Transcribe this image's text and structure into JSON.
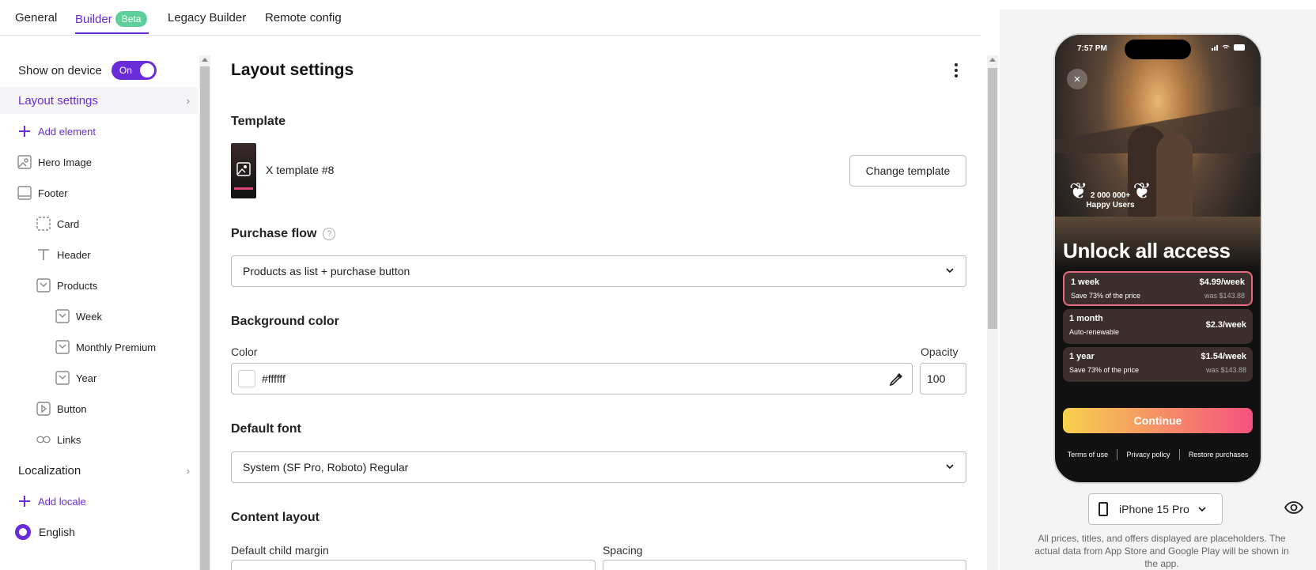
{
  "tabs": {
    "general": "General",
    "builder": "Builder",
    "builder_badge": "Beta",
    "legacy": "Legacy Builder",
    "remote": "Remote config"
  },
  "sidebar": {
    "show_on_device": "Show on device",
    "toggle_label": "On",
    "layout_settings": "Layout settings",
    "add_element": "Add element",
    "items": [
      {
        "label": "Hero Image"
      },
      {
        "label": "Footer"
      },
      {
        "label": "Card"
      },
      {
        "label": "Header"
      },
      {
        "label": "Products"
      },
      {
        "label": "Week"
      },
      {
        "label": "Monthly Premium"
      },
      {
        "label": "Year"
      },
      {
        "label": "Button"
      },
      {
        "label": "Links"
      }
    ],
    "localization": "Localization",
    "add_locale": "Add locale",
    "locale": "English"
  },
  "main": {
    "title": "Layout settings",
    "template_title": "Template",
    "template_name": "X template #8",
    "change_template": "Change template",
    "purchase_flow_title": "Purchase flow",
    "purchase_flow_help": "?",
    "purchase_flow_value": "Products as list + purchase button",
    "background_title": "Background color",
    "color_label": "Color",
    "color_value": "#ffffff",
    "opacity_label": "Opacity",
    "opacity_value": "100",
    "default_font_title": "Default font",
    "default_font_value": "System (SF Pro, Roboto) Regular",
    "content_layout_title": "Content layout",
    "child_margin_label": "Default child margin",
    "spacing_label": "Spacing"
  },
  "preview": {
    "time": "7:57 PM",
    "close": "×",
    "laurel_line1": "2 000 000+",
    "laurel_line2": "Happy Users",
    "headline": "Unlock all access",
    "plans": [
      {
        "title": "1 week",
        "subtitle": "Save 73% of the price",
        "price": "$4.99/week",
        "was": "was $143.88"
      },
      {
        "title": "1 month",
        "subtitle": "Auto-renewable",
        "price": "$2.3/week",
        "was": ""
      },
      {
        "title": "1 year",
        "subtitle": "Save 73% of the price",
        "price": "$1.54/week",
        "was": "was $143.88"
      }
    ],
    "continue": "Continue",
    "links": [
      "Terms of use",
      "Privacy policy",
      "Restore purchases"
    ],
    "device": "iPhone 15 Pro",
    "note": "All prices, titles, and offers displayed are placeholders. The actual data from App Store and Google Play will be shown in the app."
  },
  "colors": {
    "accent": "#6a2bd9",
    "badge": "#5ccf9b",
    "background_swatch": "#ffffff"
  }
}
